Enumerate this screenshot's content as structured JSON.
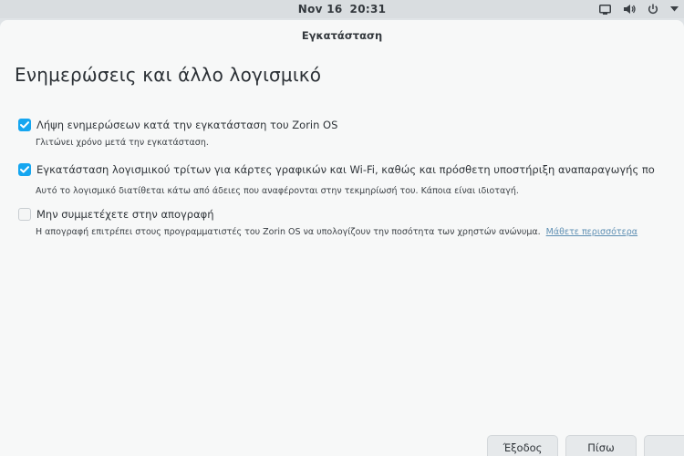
{
  "topbar": {
    "date": "Nov 16",
    "time": "20:31",
    "icons": [
      "display-icon",
      "volume-icon",
      "power-icon",
      "menu-arrow-icon"
    ]
  },
  "window": {
    "title": "Εγκατάσταση"
  },
  "page": {
    "heading": "Ενημερώσεις και άλλο λογισμικό",
    "options": [
      {
        "label": "Λήψη ενημερώσεων κατά την εγκατάσταση του Zorin OS",
        "checked": true,
        "description": "Γλιτώνει χρόνο μετά την εγκατάσταση."
      },
      {
        "label": "Εγκατάσταση λογισμικού τρίτων για κάρτες γραφικών και Wi-Fi, καθώς και πρόσθετη υποστήριξη αναπαραγωγής πο",
        "checked": true,
        "description": "Αυτό το λογισμικό διατίθεται κάτω από άδειες που αναφέρονται στην τεκμηρίωσή του. Κάποια είναι ιδιοταγή."
      },
      {
        "label": "Μην συμμετέχετε στην απογραφή",
        "checked": false,
        "description": "Η απογραφή επιτρέπει στους προγραμματιστές του Zorin OS να υπολογίζουν την ποσότητα των χρηστών ανώνυμα.",
        "link": "Μάθετε περισσότερα"
      }
    ]
  },
  "buttons": {
    "quit": "Έξοδος",
    "back": "Πίσω",
    "next": ""
  },
  "colors": {
    "accent": "#15a6f0",
    "link": "#5e8fb3"
  }
}
